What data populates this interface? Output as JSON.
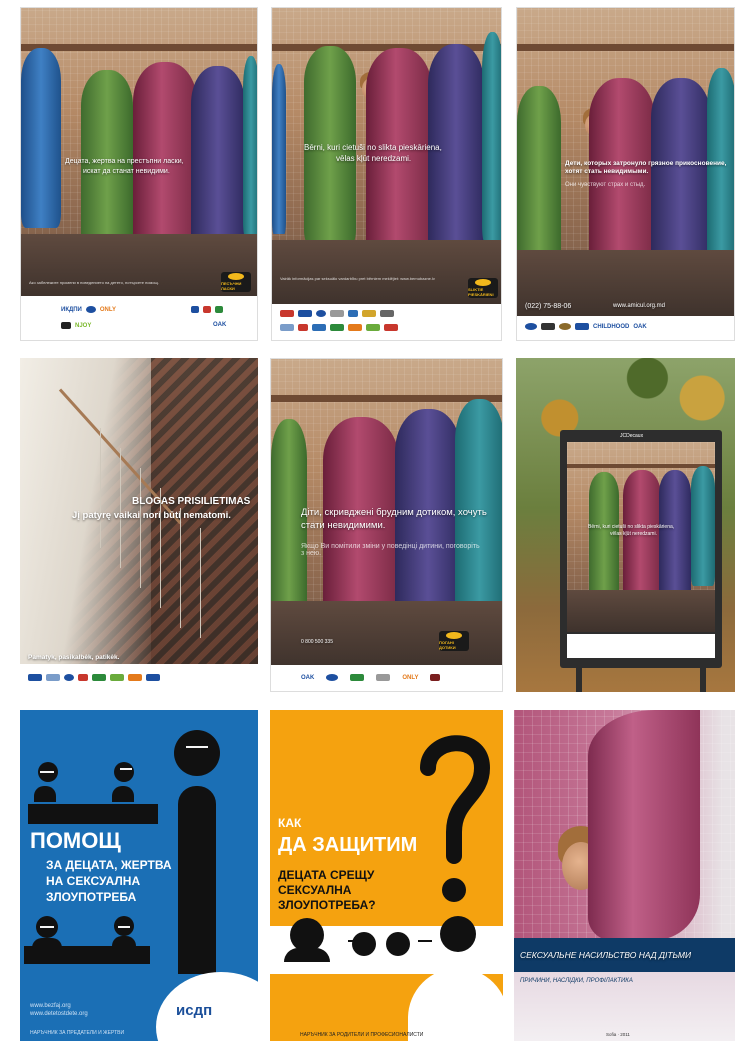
{
  "posters": {
    "p1": {
      "title": "Децата, жертва на престъпни ласки,",
      "subtitle": "искат да станат невидими.",
      "badge": "ПЕСЪЧНИ ЛАСКИ",
      "fine_print": "Ако забележите промени в поведението на детето, потърсете помощ.",
      "logos": [
        "ИКДПИ",
        "ONLY",
        "OAK",
        "NJOY"
      ]
    },
    "p2": {
      "title": "Bērni, kuri cietuši no slikta pieskāriena,",
      "subtitle": "vēlas kļūt neredzami.",
      "fine_print": "Vairāk informācijas par seksuālo vardarbību pret bērniem meklējiet: www.bernubazne.lv",
      "badge": "SLIKTIE PIESKĀRIENI"
    },
    "p3": {
      "title": "Дети, которых затронуло грязное прикосновение, хотят стать невидимыми.",
      "subtitle": "Они чувствуют страх и стыд.",
      "phone": "(022) 75-88-06",
      "site": "www.amicul.org.md",
      "logos": [
        "OAK",
        "CHILDHOOD"
      ]
    },
    "p4": {
      "title": "BLOGAS PRISILIETIMAS",
      "subtitle": "Jį patyrę vaikai nori būti nematomi.",
      "footer": "Pamatyk, pasikalbėk, patikėk."
    },
    "p5": {
      "title": "Діти, скривджені брудним дотиком, хочуть стати невидимими.",
      "subtitle": "Якщо Ви помітили зміни у поведінці дитини, поговоріть з нею.",
      "phone": "0 800 500 335",
      "badge": "ПОГАНІ ДОТИКИ",
      "logos": [
        "OAK",
        "ONLY"
      ]
    },
    "p6": {
      "brand": "JCDecaux",
      "title": "Bērni, kuri cietuši no slikta pieskāriena,",
      "subtitle": "vēlas kļūt neredzami."
    },
    "p7": {
      "title": "ПОМОЩ",
      "subtitle_lines": [
        "ЗА ДЕЦАТА, ЖЕРТВА",
        "НА СЕКСУАЛНА",
        "ЗЛОУПОТРЕБА"
      ],
      "urls": [
        "www.bezfaj.org",
        "www.detetostdete.org"
      ],
      "footer": "НАРЪЧНИК ЗА ПРЕДАТЕЛИ И ЖЕРТВИ",
      "logo": "исдп",
      "colors": {
        "background": "#1b6fb5",
        "figure": "#111111"
      }
    },
    "p8": {
      "kicker": "КАК",
      "title": "ДА ЗАЩИТИМ",
      "subtitle_lines": [
        "ДЕЦАТА СРЕЩУ",
        "СЕКСУАЛНА",
        "ЗЛОУПОТРЕБА?"
      ],
      "footer": "НАРЪЧНИК ЗА РОДИТЕЛИ И ПРОФЕСИОНАЛИСТИ",
      "colors": {
        "background": "#f5a20f",
        "figure": "#111111"
      }
    },
    "p9": {
      "title": "СЕКСУАЛЬНЕ НАСИЛЬСТВО НАД ДІТЬМИ",
      "subtitle": "ПРИЧИНИ, НАСЛІДКИ, ПРОФІЛАКТИКА",
      "footer": "Sofia · 2011",
      "colors": {
        "band": "#0e3a66"
      }
    }
  }
}
